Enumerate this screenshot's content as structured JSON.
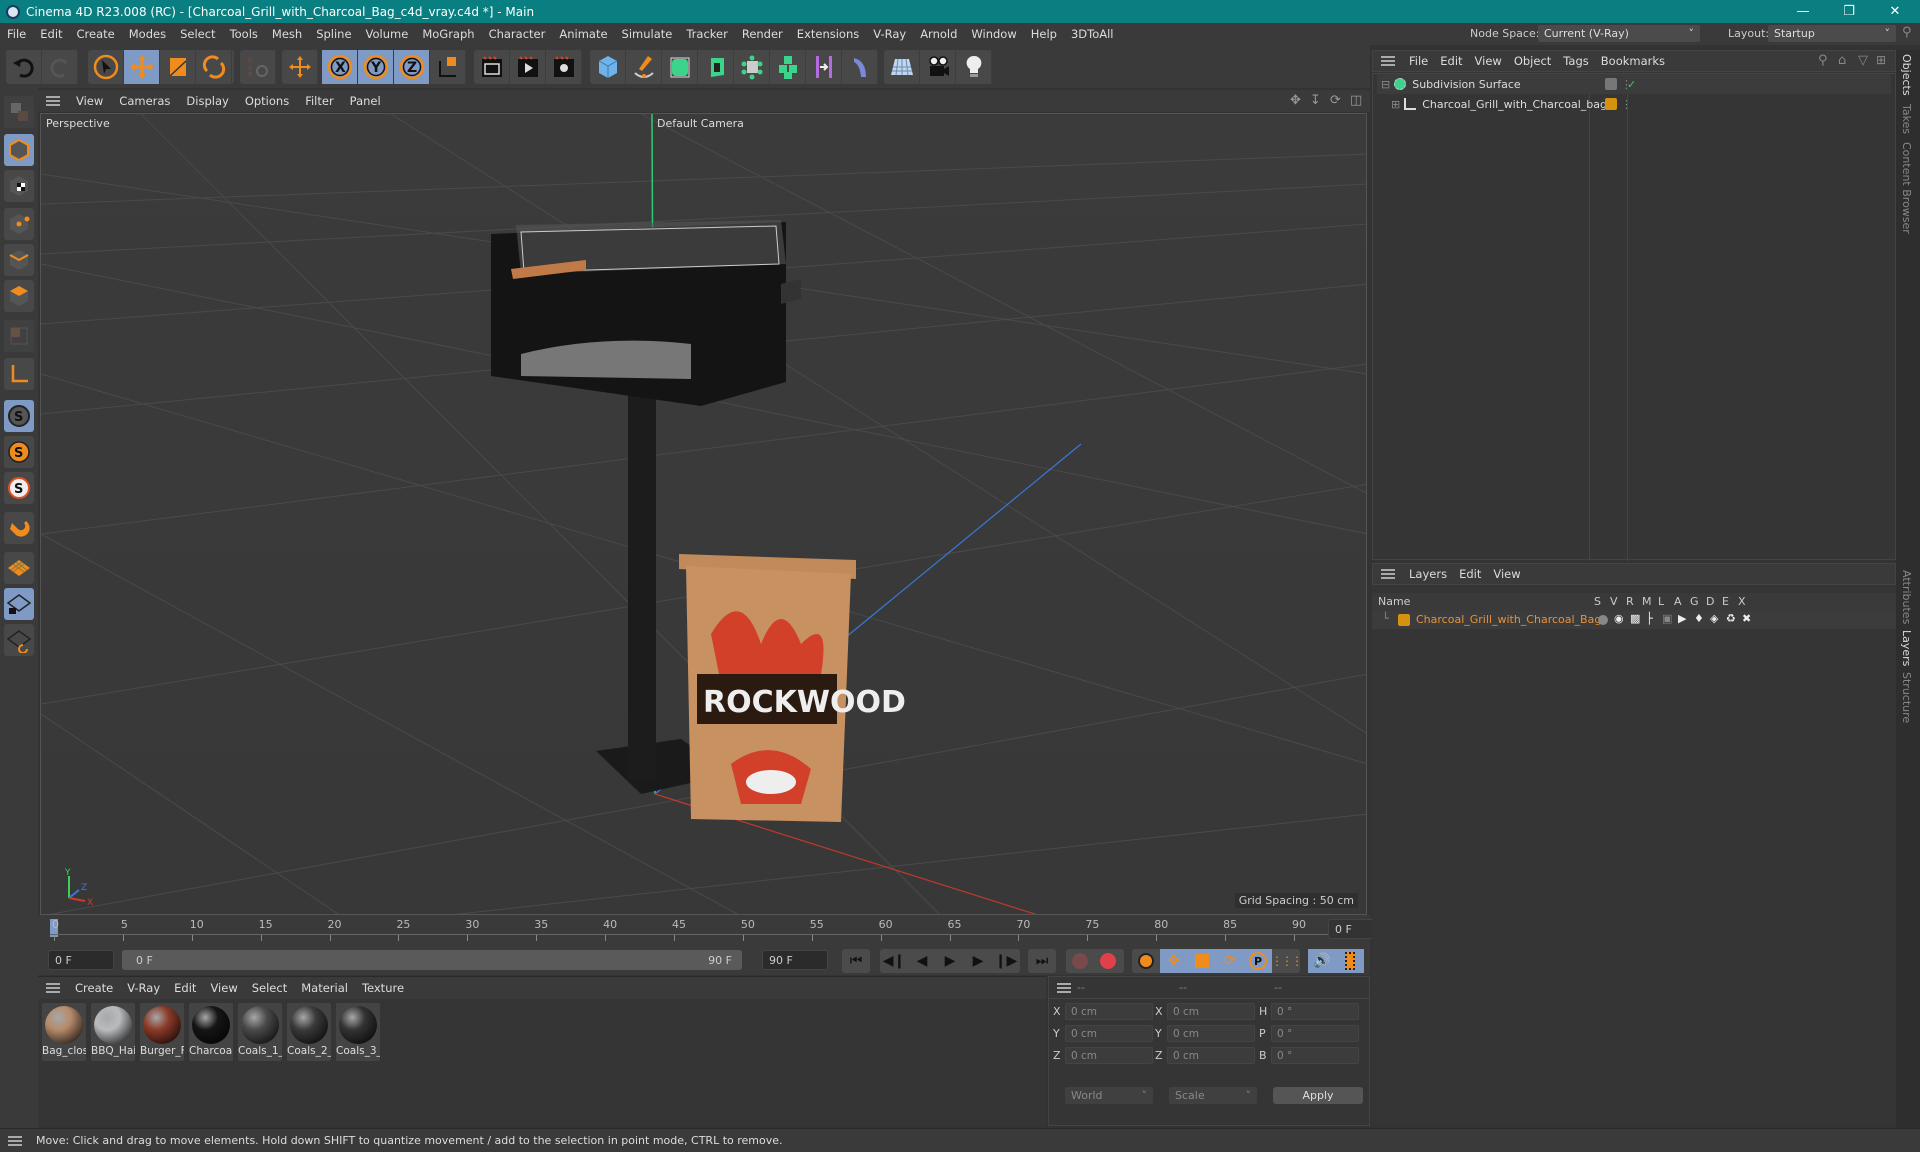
{
  "window": {
    "title": "Cinema 4D R23.008 (RC) - [Charcoal_Grill_with_Charcoal_Bag_c4d_vray.c4d *] - Main",
    "controls": [
      "minimize",
      "restore",
      "close"
    ]
  },
  "menu": [
    "File",
    "Edit",
    "Create",
    "Modes",
    "Select",
    "Tools",
    "Mesh",
    "Spline",
    "Volume",
    "MoGraph",
    "Character",
    "Animate",
    "Simulate",
    "Tracker",
    "Render",
    "Extensions",
    "V-Ray",
    "Arnold",
    "Window",
    "Help",
    "3DToAll"
  ],
  "node_space": {
    "label": "Node Space:",
    "value": "Current (V-Ray)"
  },
  "layout": {
    "label": "Layout:",
    "value": "Startup"
  },
  "viewport": {
    "menu": [
      "View",
      "Cameras",
      "Display",
      "Options",
      "Filter",
      "Panel"
    ],
    "label": "Perspective",
    "camera": "Default Camera",
    "grid_spacing": "Grid Spacing : 50 cm",
    "axis": {
      "x": "X",
      "y": "Y",
      "z": "Z"
    }
  },
  "timeline": {
    "ticks": [
      "0",
      "5",
      "10",
      "15",
      "20",
      "25",
      "30",
      "35",
      "40",
      "45",
      "50",
      "55",
      "60",
      "65",
      "70",
      "75",
      "80",
      "85",
      "90"
    ],
    "current_frame": "0 F",
    "start": "0 F",
    "range_start": "0 F",
    "range_end": "90 F",
    "end": "90 F"
  },
  "materials": {
    "menu": [
      "Create",
      "V-Ray",
      "Edit",
      "View",
      "Select",
      "Material",
      "Texture"
    ],
    "items": [
      {
        "name": "Bag_clos",
        "color": "#b58a6a"
      },
      {
        "name": "BBQ_Hai",
        "color": "#b9bcbf"
      },
      {
        "name": "Burger_F",
        "color": "#8a3a28"
      },
      {
        "name": "Charcoal",
        "color": "#151515"
      },
      {
        "name": "Coals_1_",
        "color": "#4a4a4a"
      },
      {
        "name": "Coals_2_",
        "color": "#3a3a3a"
      },
      {
        "name": "Coals_3_",
        "color": "#333333"
      }
    ]
  },
  "coords": {
    "headers": [
      "--",
      "--",
      "--"
    ],
    "rows": [
      {
        "l1": "X",
        "v1": "0 cm",
        "l2": "X",
        "v2": "0 cm",
        "l3": "H",
        "v3": "0 °"
      },
      {
        "l1": "Y",
        "v1": "0 cm",
        "l2": "Y",
        "v2": "0 cm",
        "l3": "P",
        "v3": "0 °"
      },
      {
        "l1": "Z",
        "v1": "0 cm",
        "l2": "Z",
        "v2": "0 cm",
        "l3": "B",
        "v3": "0 °"
      }
    ],
    "space": "World",
    "mode": "Scale",
    "apply": "Apply"
  },
  "objects": {
    "menu": [
      "File",
      "Edit",
      "View",
      "Object",
      "Tags",
      "Bookmarks"
    ],
    "items": [
      {
        "name": "Subdivision Surface",
        "color": "#7a7a7a"
      },
      {
        "name": "Charcoal_Grill_with_Charcoal_bag",
        "color": "#d4920f"
      }
    ]
  },
  "layers": {
    "menu": [
      "Layers",
      "Edit",
      "View"
    ],
    "columns": [
      "Name",
      "S",
      "V",
      "R",
      "M",
      "L",
      "A",
      "G",
      "D",
      "E",
      "X"
    ],
    "items": [
      {
        "name": "Charcoal_Grill_with_Charcoal_Bag",
        "color": "#d4920f"
      }
    ]
  },
  "side_tabs": {
    "top": [
      "Objects",
      "Takes",
      "Content Browser"
    ],
    "bottom": [
      "Attributes",
      "Layers",
      "Structure"
    ]
  },
  "status": "Move: Click and drag to move elements. Hold down SHIFT to quantize movement / add to the selection in point mode, CTRL to remove."
}
